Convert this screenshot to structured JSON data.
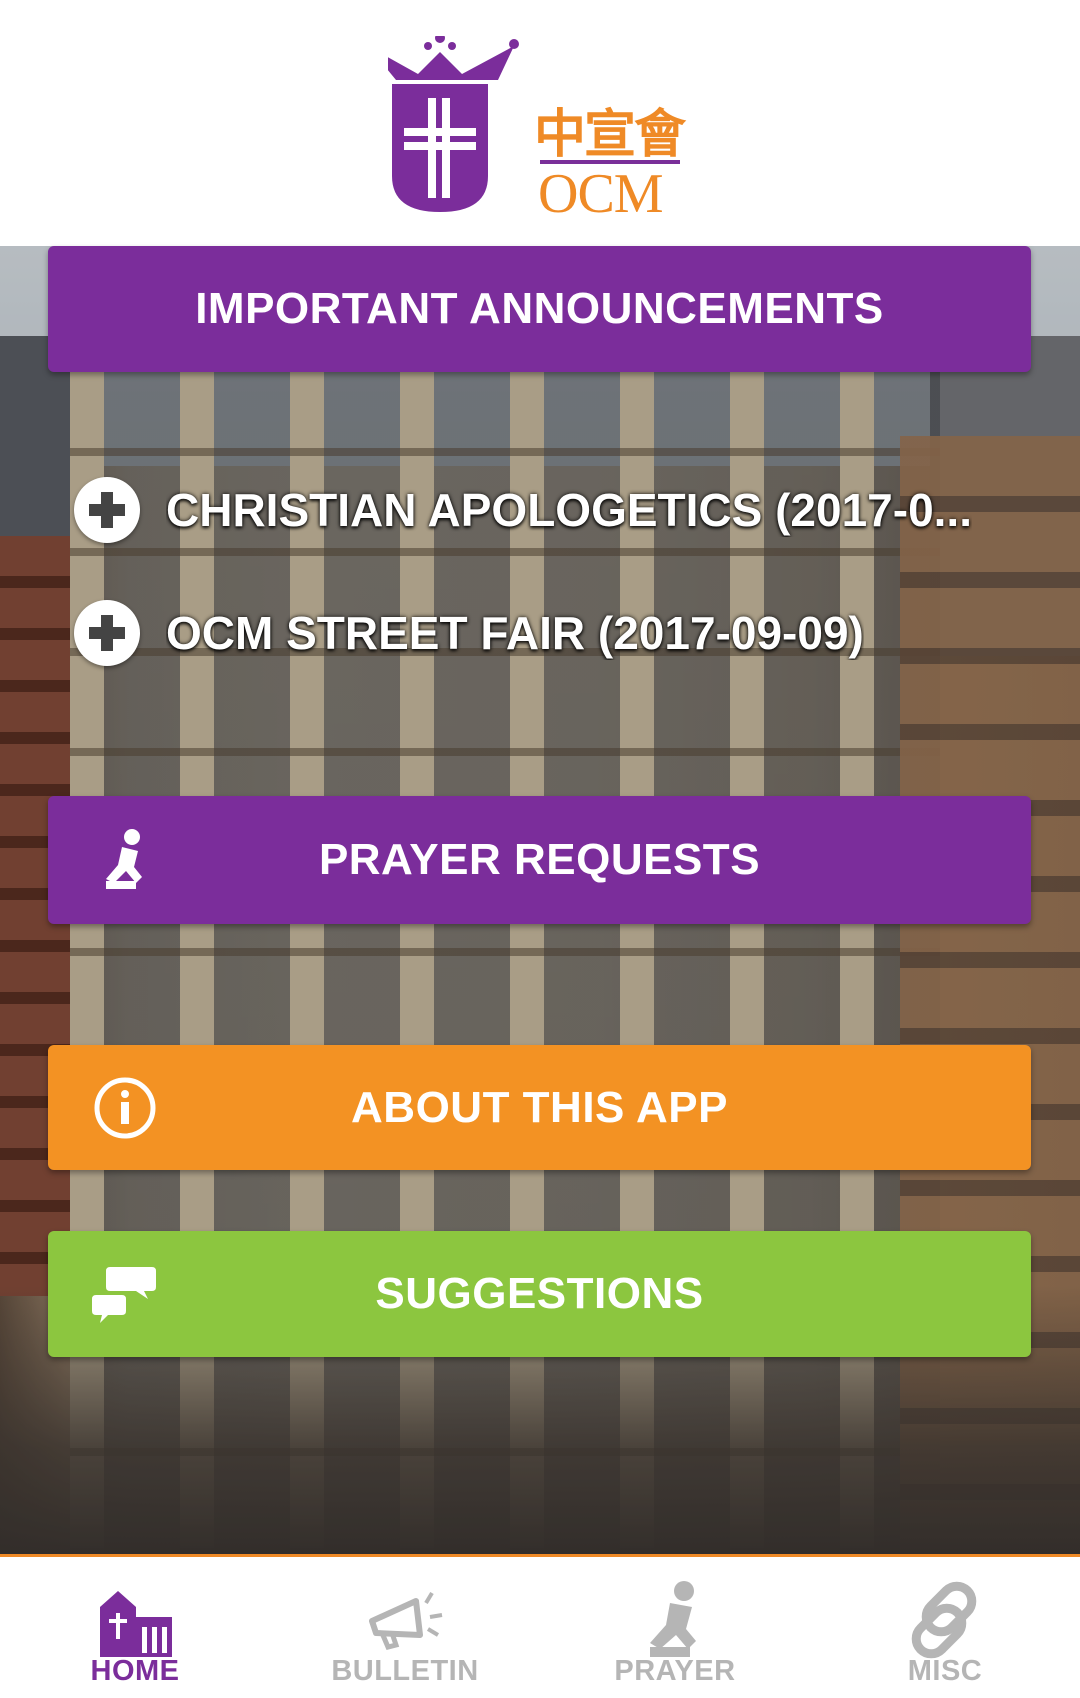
{
  "header": {
    "logo_cn": "中宣會",
    "logo_en": "OCM"
  },
  "announcements": {
    "button_label": "IMPORTANT ANNOUNCEMENTS",
    "items": [
      {
        "label": "CHRISTIAN APOLOGETICS (2017-0..."
      },
      {
        "label": "OCM STREET FAIR (2017-09-09)"
      }
    ]
  },
  "buttons": {
    "prayer_requests": "PRAYER REQUESTS",
    "about": "ABOUT THIS APP",
    "suggestions": "SUGGESTIONS"
  },
  "bottom_nav": {
    "items": [
      {
        "label": "HOME",
        "icon": "church-icon",
        "active": true
      },
      {
        "label": "BULLETIN",
        "icon": "megaphone-icon",
        "active": false
      },
      {
        "label": "PRAYER",
        "icon": "praying-person-icon",
        "active": false
      },
      {
        "label": "MISC",
        "icon": "link-icon",
        "active": false
      }
    ]
  },
  "colors": {
    "purple": "#7b2d9b",
    "orange": "#f39223",
    "green": "#8cc63f",
    "nav_inactive": "#b5b5b5",
    "nav_border": "#ef8a26"
  }
}
